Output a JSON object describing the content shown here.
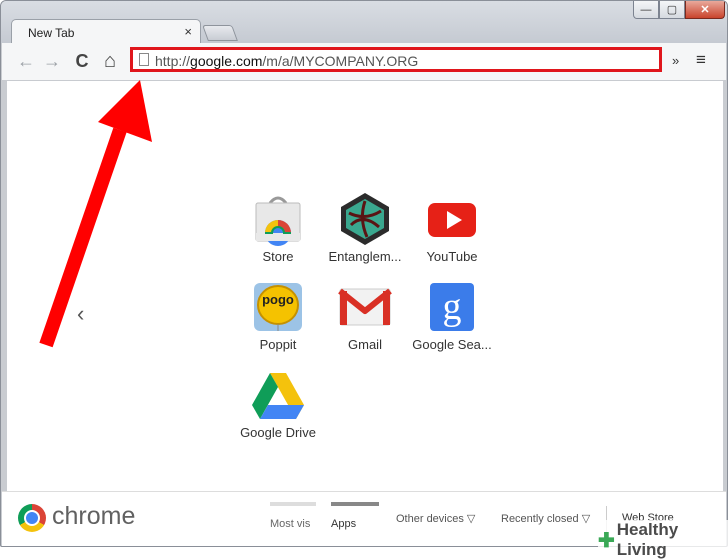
{
  "tab": {
    "title": "New Tab",
    "close": "×"
  },
  "window_controls": {
    "minimize": "—",
    "maximize": "▢",
    "close": "✕"
  },
  "toolbar": {
    "back": "←",
    "forward": "→",
    "reload": "C",
    "home": "⌂",
    "url_scheme": "http://",
    "url_host": "google.com",
    "url_path": "/m/a/MYCOMPANY.ORG",
    "extensions": "»",
    "menu": "≡"
  },
  "content": {
    "prev_arrow": "‹",
    "apps": [
      {
        "label": "Store",
        "icon": "chrome-web-store-icon"
      },
      {
        "label": "Entanglem...",
        "icon": "entanglement-game-icon"
      },
      {
        "label": "YouTube",
        "icon": "youtube-icon"
      },
      {
        "label": "Poppit",
        "icon": "pogo-poppit-icon"
      },
      {
        "label": "Gmail",
        "icon": "gmail-icon"
      },
      {
        "label": "Google Sea...",
        "icon": "google-search-icon"
      },
      {
        "label": "Google Drive",
        "icon": "google-drive-icon"
      }
    ]
  },
  "footer": {
    "brand": "chrome",
    "tabs": [
      {
        "label": "Most vis"
      },
      {
        "label": "Apps"
      }
    ],
    "other_devices": "Other devices ▽",
    "recently_closed": "Recently closed ▽",
    "web_store": "Web Store"
  },
  "watermark": {
    "cross": "✚",
    "text": "Healthy Living"
  },
  "colors": {
    "highlight": "#e0161c",
    "arrow": "#ff0000"
  }
}
